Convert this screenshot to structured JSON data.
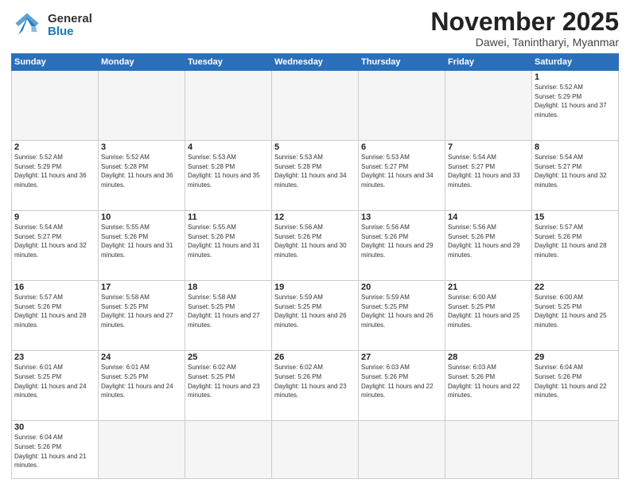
{
  "logo": {
    "general": "General",
    "blue": "Blue"
  },
  "header": {
    "month": "November 2025",
    "location": "Dawei, Tanintharyi, Myanmar"
  },
  "weekdays": [
    "Sunday",
    "Monday",
    "Tuesday",
    "Wednesday",
    "Thursday",
    "Friday",
    "Saturday"
  ],
  "weeks": [
    [
      null,
      null,
      null,
      null,
      null,
      null,
      {
        "day": "1",
        "sunrise": "5:52 AM",
        "sunset": "5:29 PM",
        "daylight": "11 hours and 37 minutes."
      }
    ],
    [
      {
        "day": "2",
        "sunrise": "5:52 AM",
        "sunset": "5:29 PM",
        "daylight": "11 hours and 36 minutes."
      },
      {
        "day": "3",
        "sunrise": "5:52 AM",
        "sunset": "5:28 PM",
        "daylight": "11 hours and 36 minutes."
      },
      {
        "day": "4",
        "sunrise": "5:53 AM",
        "sunset": "5:28 PM",
        "daylight": "11 hours and 35 minutes."
      },
      {
        "day": "5",
        "sunrise": "5:53 AM",
        "sunset": "5:28 PM",
        "daylight": "11 hours and 34 minutes."
      },
      {
        "day": "6",
        "sunrise": "5:53 AM",
        "sunset": "5:27 PM",
        "daylight": "11 hours and 34 minutes."
      },
      {
        "day": "7",
        "sunrise": "5:54 AM",
        "sunset": "5:27 PM",
        "daylight": "11 hours and 33 minutes."
      },
      {
        "day": "8",
        "sunrise": "5:54 AM",
        "sunset": "5:27 PM",
        "daylight": "11 hours and 32 minutes."
      }
    ],
    [
      {
        "day": "9",
        "sunrise": "5:54 AM",
        "sunset": "5:27 PM",
        "daylight": "11 hours and 32 minutes."
      },
      {
        "day": "10",
        "sunrise": "5:55 AM",
        "sunset": "5:26 PM",
        "daylight": "11 hours and 31 minutes."
      },
      {
        "day": "11",
        "sunrise": "5:55 AM",
        "sunset": "5:26 PM",
        "daylight": "11 hours and 31 minutes."
      },
      {
        "day": "12",
        "sunrise": "5:56 AM",
        "sunset": "5:26 PM",
        "daylight": "11 hours and 30 minutes."
      },
      {
        "day": "13",
        "sunrise": "5:56 AM",
        "sunset": "5:26 PM",
        "daylight": "11 hours and 29 minutes."
      },
      {
        "day": "14",
        "sunrise": "5:56 AM",
        "sunset": "5:26 PM",
        "daylight": "11 hours and 29 minutes."
      },
      {
        "day": "15",
        "sunrise": "5:57 AM",
        "sunset": "5:26 PM",
        "daylight": "11 hours and 28 minutes."
      }
    ],
    [
      {
        "day": "16",
        "sunrise": "5:57 AM",
        "sunset": "5:26 PM",
        "daylight": "11 hours and 28 minutes."
      },
      {
        "day": "17",
        "sunrise": "5:58 AM",
        "sunset": "5:25 PM",
        "daylight": "11 hours and 27 minutes."
      },
      {
        "day": "18",
        "sunrise": "5:58 AM",
        "sunset": "5:25 PM",
        "daylight": "11 hours and 27 minutes."
      },
      {
        "day": "19",
        "sunrise": "5:59 AM",
        "sunset": "5:25 PM",
        "daylight": "11 hours and 26 minutes."
      },
      {
        "day": "20",
        "sunrise": "5:59 AM",
        "sunset": "5:25 PM",
        "daylight": "11 hours and 26 minutes."
      },
      {
        "day": "21",
        "sunrise": "6:00 AM",
        "sunset": "5:25 PM",
        "daylight": "11 hours and 25 minutes."
      },
      {
        "day": "22",
        "sunrise": "6:00 AM",
        "sunset": "5:25 PM",
        "daylight": "11 hours and 25 minutes."
      }
    ],
    [
      {
        "day": "23",
        "sunrise": "6:01 AM",
        "sunset": "5:25 PM",
        "daylight": "11 hours and 24 minutes."
      },
      {
        "day": "24",
        "sunrise": "6:01 AM",
        "sunset": "5:25 PM",
        "daylight": "11 hours and 24 minutes."
      },
      {
        "day": "25",
        "sunrise": "6:02 AM",
        "sunset": "5:25 PM",
        "daylight": "11 hours and 23 minutes."
      },
      {
        "day": "26",
        "sunrise": "6:02 AM",
        "sunset": "5:26 PM",
        "daylight": "11 hours and 23 minutes."
      },
      {
        "day": "27",
        "sunrise": "6:03 AM",
        "sunset": "5:26 PM",
        "daylight": "11 hours and 22 minutes."
      },
      {
        "day": "28",
        "sunrise": "6:03 AM",
        "sunset": "5:26 PM",
        "daylight": "11 hours and 22 minutes."
      },
      {
        "day": "29",
        "sunrise": "6:04 AM",
        "sunset": "5:26 PM",
        "daylight": "11 hours and 22 minutes."
      }
    ],
    [
      {
        "day": "30",
        "sunrise": "6:04 AM",
        "sunset": "5:26 PM",
        "daylight": "11 hours and 21 minutes."
      },
      null,
      null,
      null,
      null,
      null,
      null
    ]
  ],
  "labels": {
    "sunrise": "Sunrise:",
    "sunset": "Sunset:",
    "daylight": "Daylight:"
  }
}
